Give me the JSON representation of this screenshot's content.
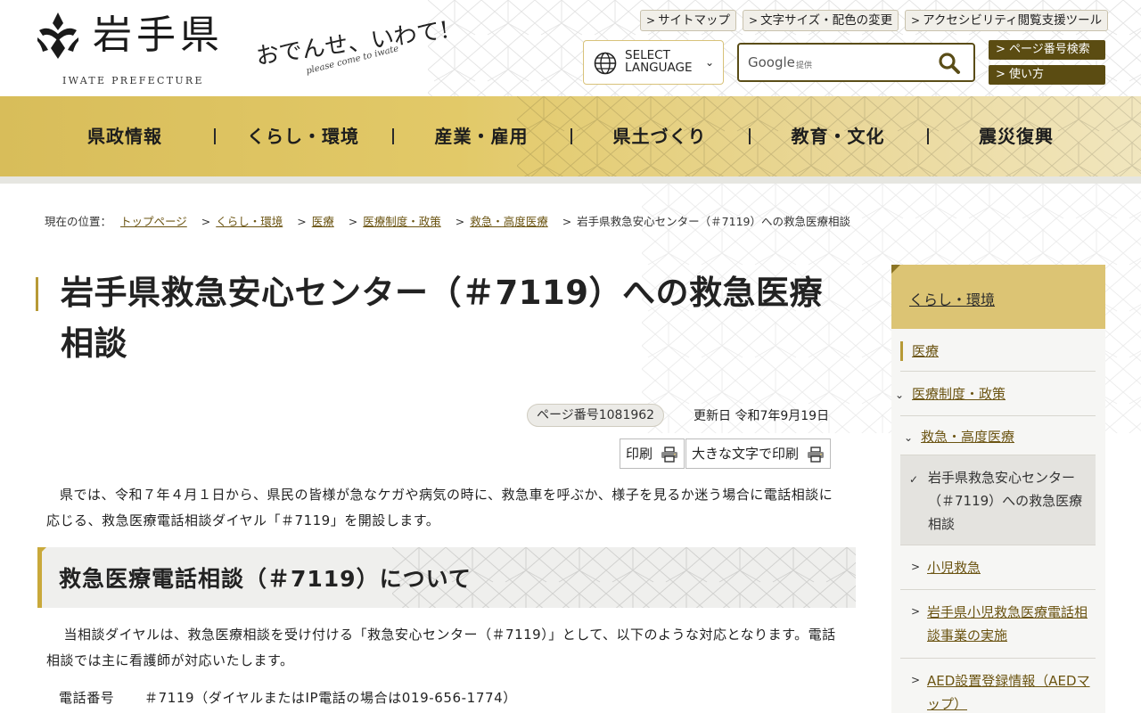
{
  "header": {
    "logo_name": "岩手県",
    "logo_en": "IWATE PREFECTURE",
    "slogan": "おでんせ、いわて!",
    "slogan_sub": "please come to iwate",
    "util_links": [
      "サイトマップ",
      "文字サイズ・配色の変更",
      "アクセシビリティ閲覧支援ツール"
    ],
    "lang_label_1": "SELECT",
    "lang_label_2": "LANGUAGE",
    "search_brand": "Google",
    "search_brand_sub": "提供",
    "search_placeholder": "",
    "page_search_label": "ページ番号検索",
    "howto_label": "使い方"
  },
  "nav": {
    "items": [
      "県政情報",
      "くらし・環境",
      "産業・雇用",
      "県土づくり",
      "教育・文化",
      "震災復興"
    ]
  },
  "breadcrumb": {
    "prefix": "現在の位置：",
    "links": [
      "トップページ",
      "くらし・環境",
      "医療",
      "医療制度・政策",
      "救急・高度医療"
    ],
    "current": "岩手県救急安心センター（＃7119）への救急医療相談"
  },
  "page": {
    "title": "岩手県救急安心センター（＃7119）への救急医療相談",
    "page_number": "ページ番号1081962",
    "updated": "更新日 令和7年9月19日",
    "print_label": "印刷",
    "print_large_label": "大きな文字で印刷",
    "intro": "県では、令和７年４月１日から、県民の皆様が急なケガや病気の時に、救急車を呼ぶか、様子を見るか迷う場合に電話相談に応じる、救急医療電話相談ダイヤル「＃7119」を開設します。",
    "section_heading": "救急医療電話相談（＃7119）について",
    "section_body": "当相談ダイヤルは、救急医療相談を受け付ける「救急安心センター（＃7119）」として、以下のような対応となります。電話相談では主に看護師が対応いたします。",
    "phone_label": "電話番号",
    "phone_value": "＃7119（ダイヤルまたはIP電話の場合は019-656-1774）"
  },
  "sidebar": {
    "heading": "くらし・環境",
    "items": [
      {
        "label": "医療"
      },
      {
        "label": "医療制度・政策"
      },
      {
        "label": "救急・高度医療"
      },
      {
        "label": "岩手県救急安心センター（＃7119）への救急医療相談"
      },
      {
        "label": "小児救急"
      },
      {
        "label": "岩手県小児救急医療電話相談事業の実施"
      },
      {
        "label": "AED設置登録情報（AEDマップ）"
      }
    ]
  },
  "colors": {
    "gold": "#dcc474",
    "brown": "#5b4c12",
    "link": "#6b5412"
  }
}
